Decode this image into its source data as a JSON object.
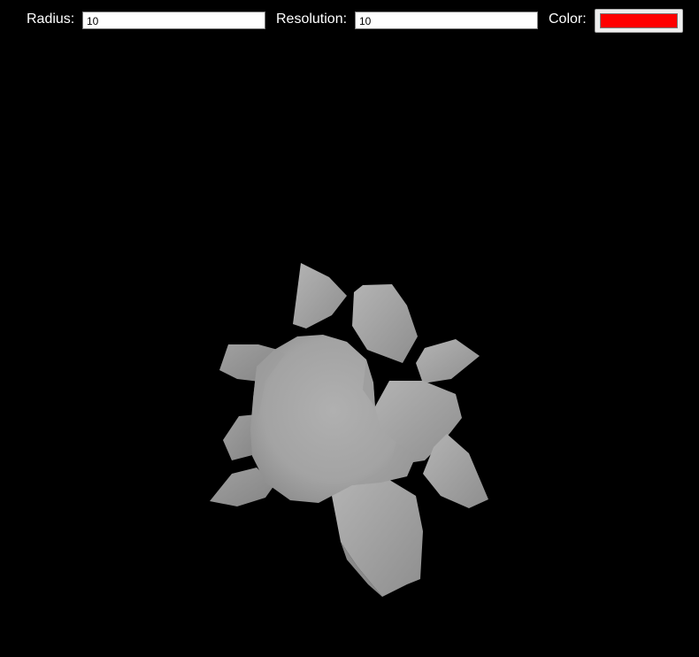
{
  "controls": {
    "radius": {
      "label": "Radius:",
      "value": "10"
    },
    "resolution": {
      "label": "Resolution:",
      "value": "10"
    },
    "color": {
      "label": "Color:",
      "value": "#ff0000"
    }
  },
  "scene": {
    "background": "#000000",
    "mesh_color": "#a9a9a9"
  }
}
